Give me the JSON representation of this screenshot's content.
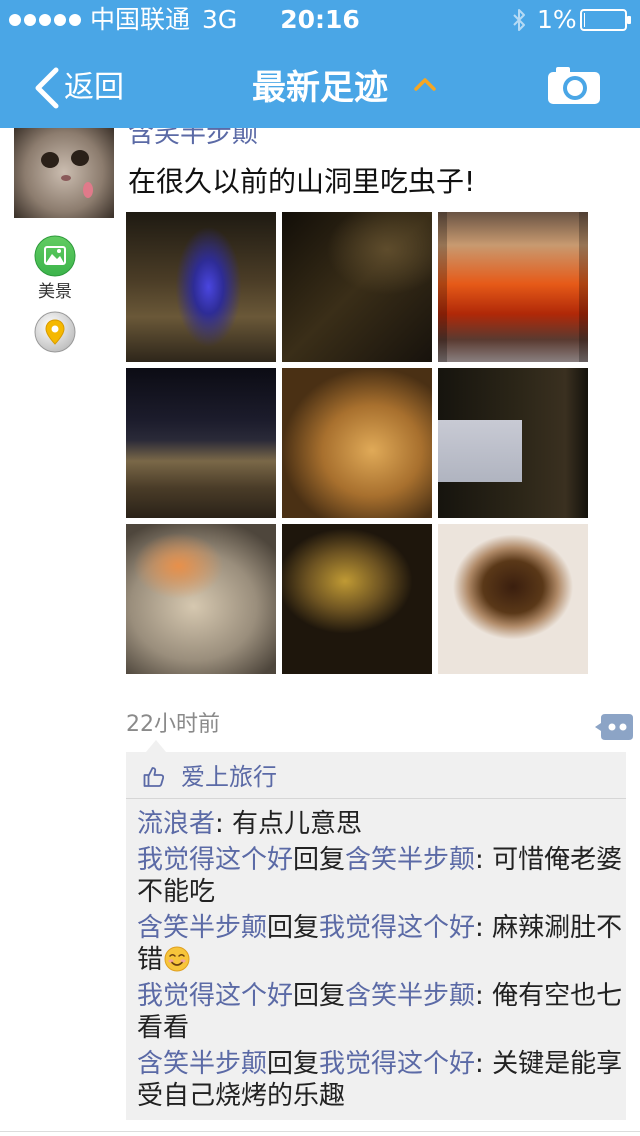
{
  "status_bar": {
    "signal_icon": "signal-strength-dots-icon",
    "carrier": "中国联通",
    "network": "3G",
    "time": "20:16",
    "bluetooth_icon": "bluetooth-icon",
    "battery_text": "1%",
    "battery_icon": "battery-icon",
    "battery_level": 0.01
  },
  "nav_bar": {
    "back_icon": "chevron-left-icon",
    "back_label": "返回",
    "title": "最新足迹",
    "title_toggle_icon": "chevron-up-icon",
    "camera_icon": "camera-icon"
  },
  "colors": {
    "nav_background": "#4aa6e6",
    "link": "#5b6aa6",
    "title_toggle": "#f5a623",
    "category_green": "#3cb44b",
    "comment_box_background": "#f0f0f0"
  },
  "post": {
    "author": "含笑半步颠",
    "avatar_icon": "cat-avatar",
    "text": "在很久以前的山洞里吃虫子!",
    "category_icon": "landscape-icon",
    "category_label": "美景",
    "location_icon": "location-pin-icon",
    "time_ago": "22小时前",
    "comment_button_icon": "comment-more-icon"
  },
  "likes": {
    "icon": "thumbs-up-icon",
    "user": "爱上旅行"
  },
  "comment_separator": ": ",
  "comments": [
    {
      "author": "流浪者",
      "reply_label": "",
      "reply_to": "",
      "text": "有点儿意思"
    },
    {
      "author": "我觉得这个好",
      "reply_label": "回复",
      "reply_to": "含笑半步颠",
      "text": "可惜俺老婆不能吃"
    },
    {
      "author": "含笑半步颠",
      "reply_label": "回复",
      "reply_to": "我觉得这个好",
      "text": "麻辣涮肚不错",
      "emoji": "smiling-face-emoji-icon"
    },
    {
      "author": "我觉得这个好",
      "reply_label": "回复",
      "reply_to": "含笑半步颠",
      "text": "俺有空也七看看"
    },
    {
      "author": "含笑半步颠",
      "reply_label": "回复",
      "reply_to": "我觉得这个好",
      "text": "关键是能享受自己烧烤的乐趣"
    }
  ]
}
